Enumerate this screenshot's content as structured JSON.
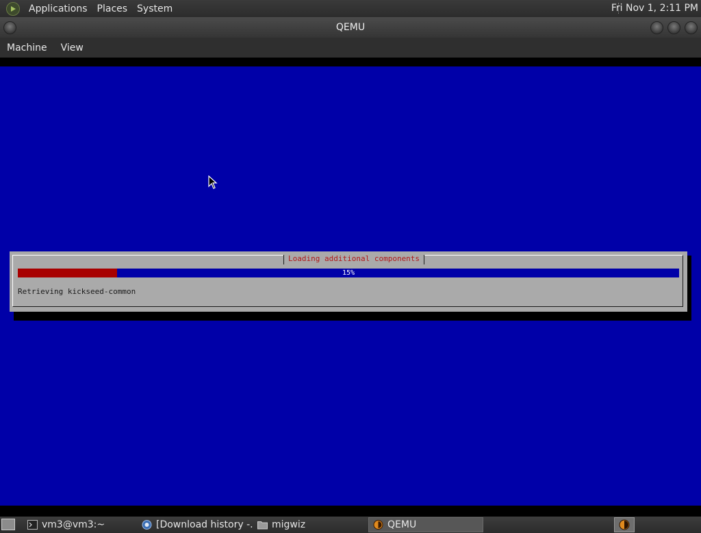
{
  "top_panel": {
    "menus": [
      "Applications",
      "Places",
      "System"
    ],
    "clock": "Fri Nov 1,  2:11 PM"
  },
  "window": {
    "title": "QEMU",
    "menu": [
      "Machine",
      "View"
    ]
  },
  "installer": {
    "dialog_title": "Loading additional components",
    "progress_percent": 15,
    "progress_label": "15%",
    "status": "Retrieving kickseed-common",
    "colors": {
      "screen": "#0000a8",
      "dialog": "#aaaaaa",
      "progress_fill": "#a80000",
      "title_text": "#b01818"
    }
  },
  "taskbar": {
    "tasks": [
      {
        "label": "vm3@vm3:~",
        "icon": "terminal-icon"
      },
      {
        "label": "[Download history -...",
        "icon": "browser-icon"
      },
      {
        "label": "migwiz",
        "icon": "folder-icon"
      },
      {
        "label": "QEMU",
        "icon": "qemu-icon"
      }
    ]
  }
}
